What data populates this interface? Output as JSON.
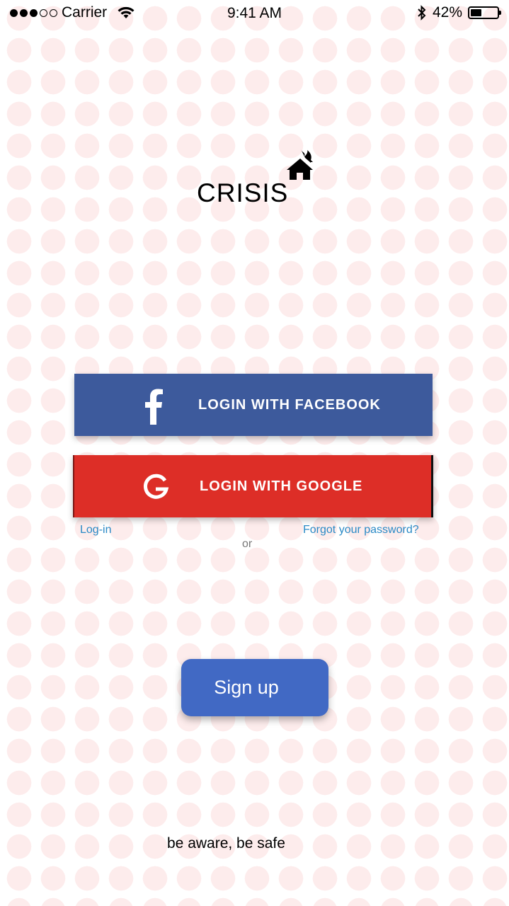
{
  "status_bar": {
    "carrier": "Carrier",
    "time": "9:41 AM",
    "battery_percent": "42%",
    "battery_level": 0.42
  },
  "logo": {
    "title": "CRISIS",
    "icon": "burning-house-icon"
  },
  "buttons": {
    "facebook_label": "LOGIN WITH FACEBOOK",
    "google_label": "LOGIN WITH GOOGLE",
    "signup_label": "Sign up"
  },
  "links": {
    "login": "Log-in",
    "forgot_password": "Forgot your password?",
    "or": "or"
  },
  "tagline": "be aware, be safe",
  "colors": {
    "facebook": "#3d5a9c",
    "google": "#dd2e27",
    "signup": "#4169c4",
    "link": "#2a8ac6",
    "background_dots": "#fdecec"
  }
}
